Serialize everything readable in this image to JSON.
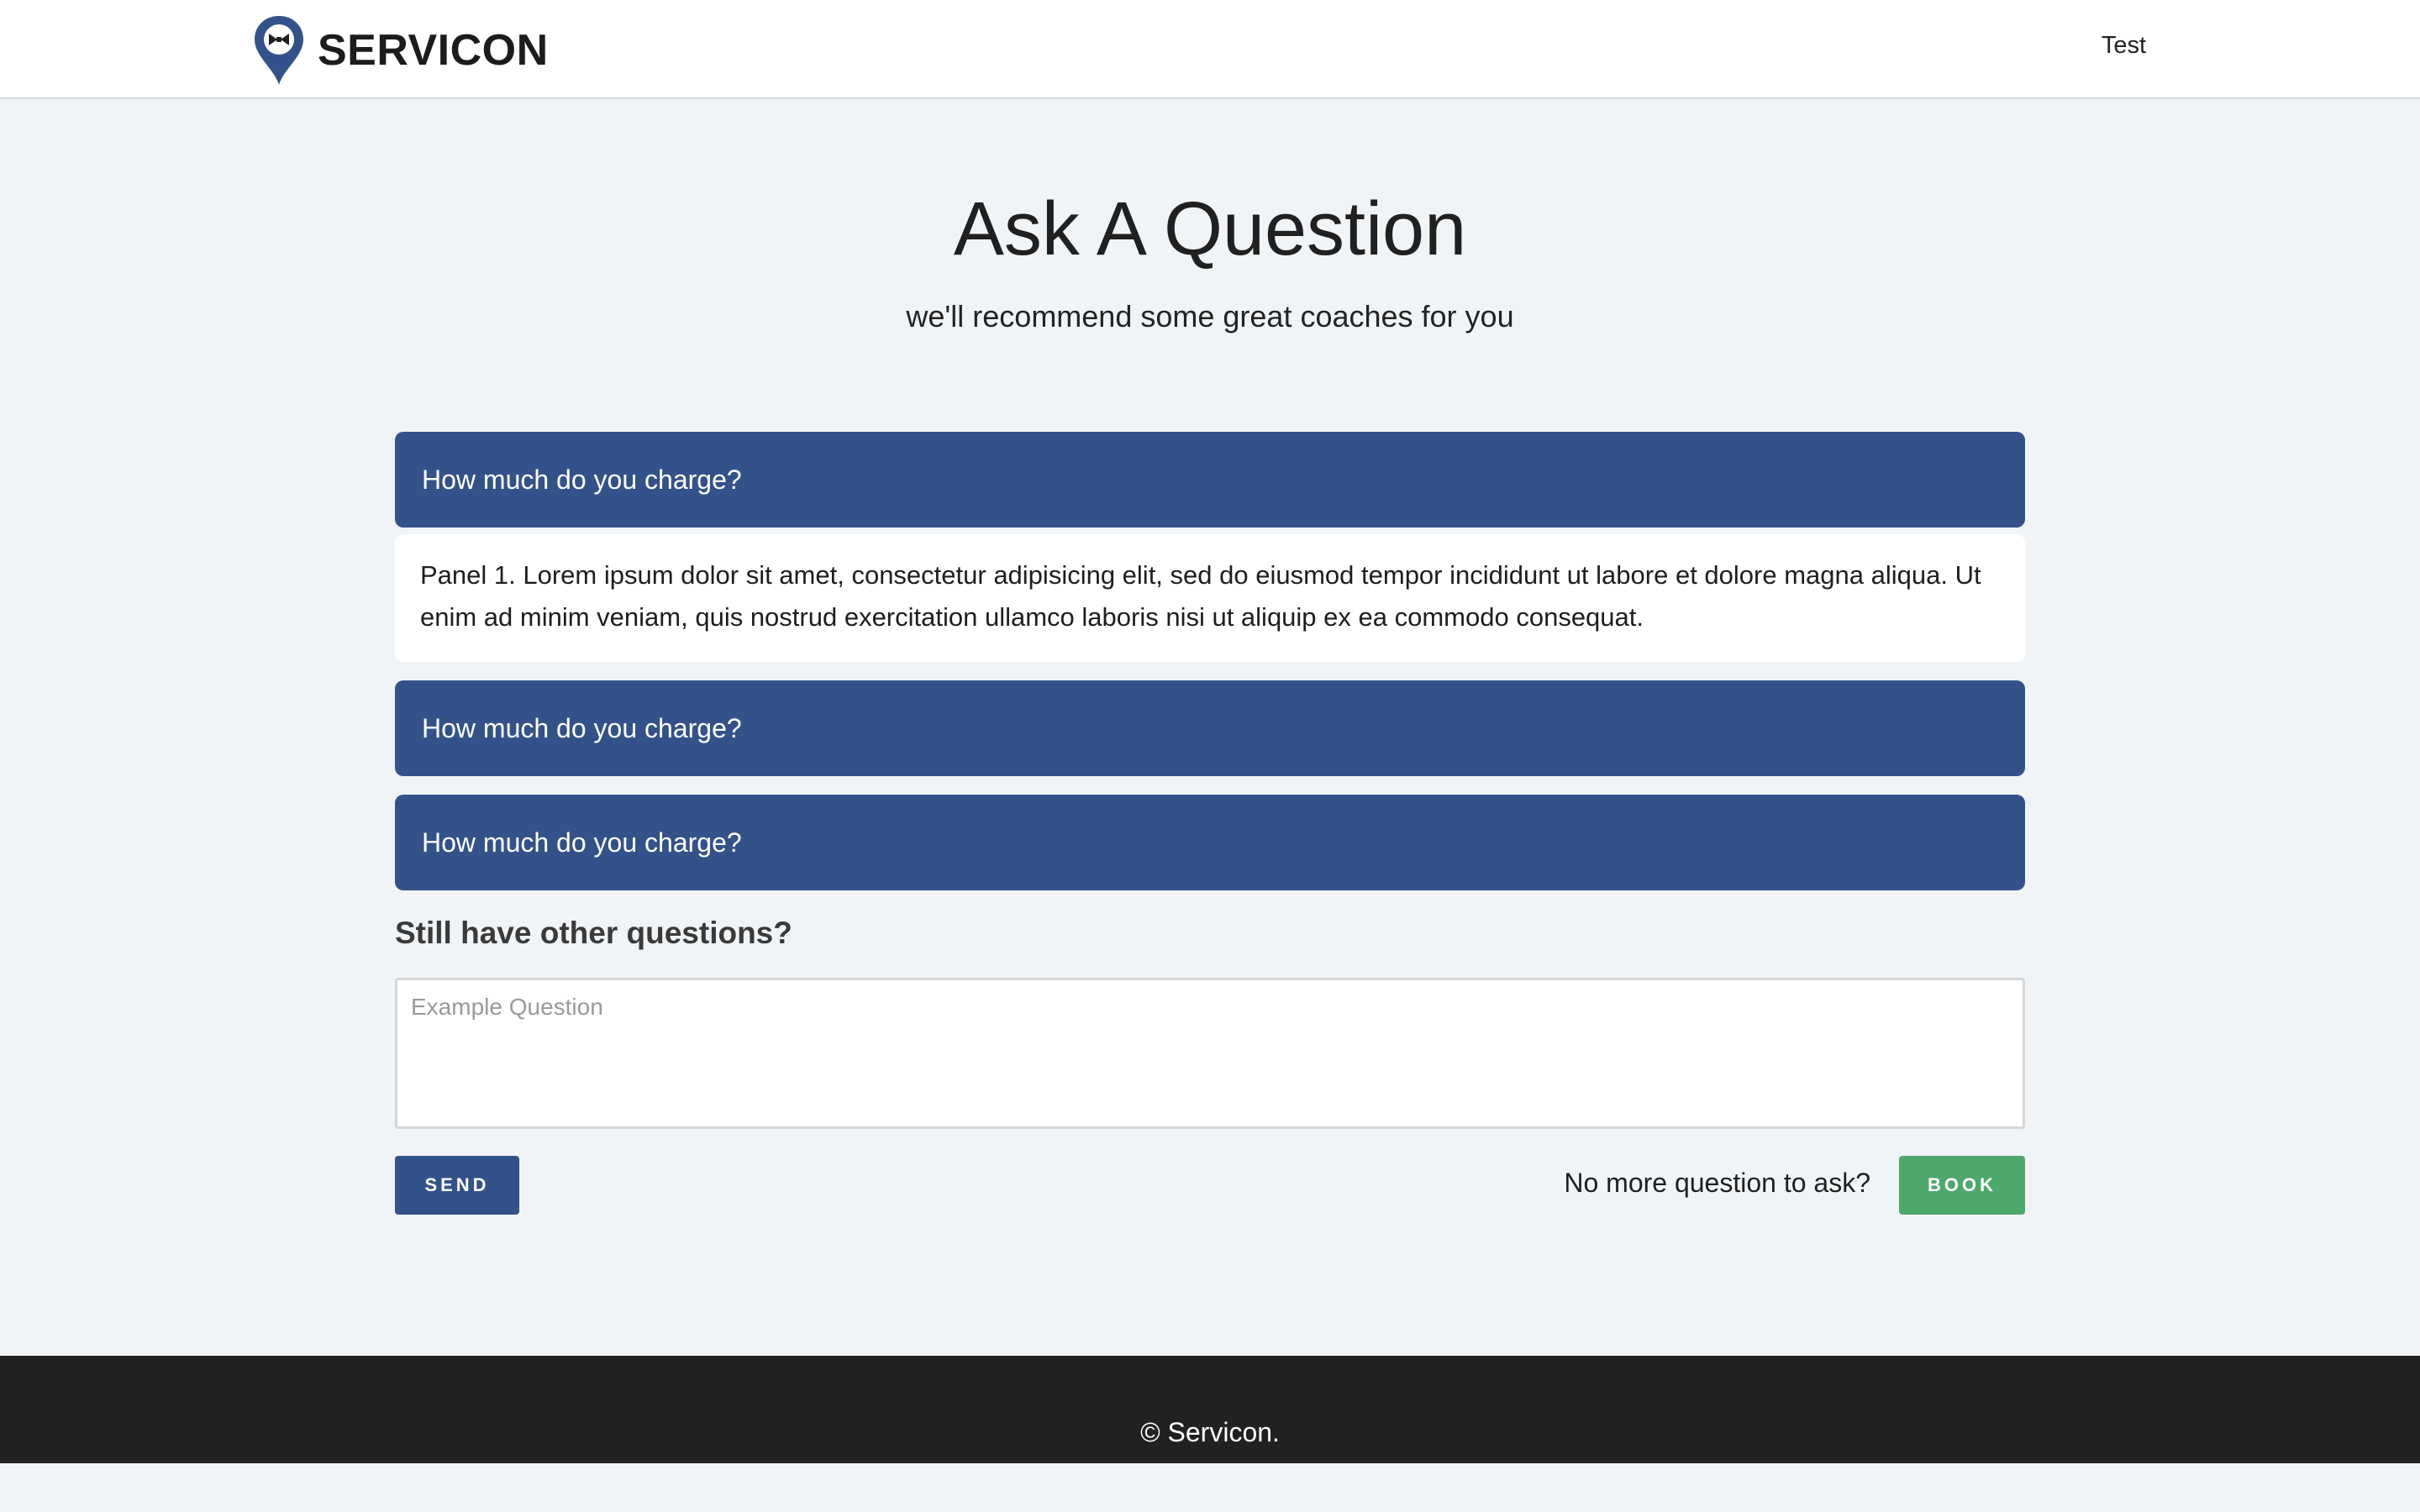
{
  "header": {
    "brand_name": "SERVICON",
    "logo_icon": "map-pin-bowtie-icon",
    "user_label": "Test"
  },
  "hero": {
    "title": "Ask A Question",
    "subtitle": "we'll recommend some great coaches for you"
  },
  "faq": {
    "panels": [
      {
        "question": "How much do you charge?",
        "expanded": true,
        "answer": "Panel 1. Lorem ipsum dolor sit amet, consectetur adipisicing elit, sed do eiusmod tempor incididunt ut labore et dolore magna aliqua. Ut enim ad minim veniam, quis nostrud exercitation ullamco laboris nisi ut aliquip ex ea commodo consequat."
      },
      {
        "question": "How much do you charge?",
        "expanded": false
      },
      {
        "question": "How much do you charge?",
        "expanded": false
      }
    ]
  },
  "form": {
    "label": "Still have other questions?",
    "placeholder": "Example Question",
    "value": "",
    "send_label": "SEND",
    "book_prompt": "No more question to ask?",
    "book_label": "BOOK"
  },
  "footer": {
    "copyright": "© Servicon."
  },
  "colors": {
    "primary": "#33528a",
    "success": "#4ca96b",
    "page_background": "#f1f4f7",
    "footer_background": "#212121"
  }
}
